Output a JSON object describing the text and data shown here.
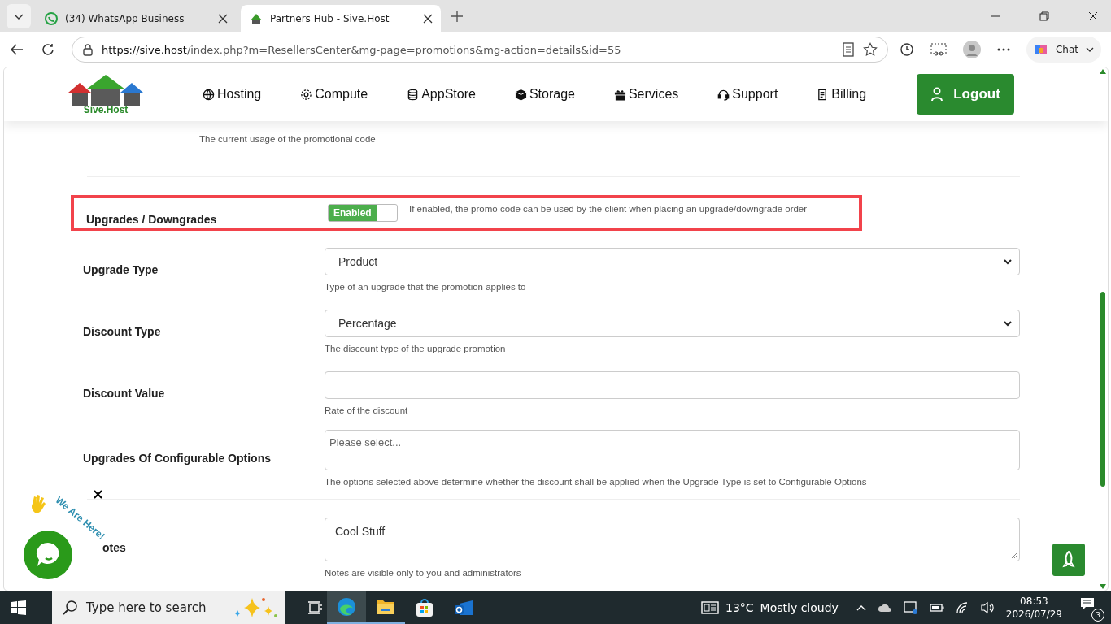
{
  "browser": {
    "tabs": [
      {
        "title": "(34) WhatsApp Business",
        "selected": false
      },
      {
        "title": "Partners Hub - Sive.Host",
        "selected": true
      }
    ],
    "url_host": "https://sive.host",
    "url_path": "/index.php?m=ResellersCenter&mg-page=promotions&mg-action=details&id=55",
    "chat_label": "Chat"
  },
  "site": {
    "logo_text": "Sive.Host",
    "nav": [
      {
        "label": "Hosting"
      },
      {
        "label": "Compute"
      },
      {
        "label": "AppStore"
      },
      {
        "label": "Storage"
      },
      {
        "label": "Services"
      },
      {
        "label": "Support"
      },
      {
        "label": "Billing"
      }
    ],
    "logout": "Logout"
  },
  "form": {
    "uses_hint": "The current usage of the promotional code",
    "rows": [
      {
        "kind": "toggle",
        "label": "Upgrades / Downgrades",
        "toggle_label": "Enabled",
        "on": true,
        "highlighted": true,
        "hint": "If enabled, the promo code can be used by the client when placing an upgrade/downgrade order"
      },
      {
        "kind": "select",
        "label": "Upgrade Type",
        "value": "Product",
        "hint": "Type of an upgrade that the promotion applies to"
      },
      {
        "kind": "select",
        "label": "Discount Type",
        "value": "Percentage",
        "hint": "The discount type of the upgrade promotion"
      },
      {
        "kind": "input",
        "label": "Discount Value",
        "hint": "Rate of the discount"
      },
      {
        "kind": "multiselect",
        "label": "Upgrades Of Configurable Options",
        "placeholder": "Please select...",
        "hint": "The options selected above determine whether the discount shall be applied when the Upgrade Type is set to Configurable Options"
      },
      {
        "kind": "textarea",
        "label": "otes",
        "value": "Cool Stuff",
        "hint": "Notes are visible only to you and administrators"
      }
    ]
  },
  "chat_widget": {
    "caption": "We Are Here!"
  },
  "taskbar": {
    "search_placeholder": "Type here to search",
    "apps": [
      {
        "kind": "edge",
        "selected": true,
        "running": true
      },
      {
        "kind": "explorer",
        "selected": false,
        "running": true
      },
      {
        "kind": "store",
        "selected": false,
        "running": false
      },
      {
        "kind": "outlook",
        "selected": false,
        "running": false
      }
    ],
    "temperature": "13°C",
    "weather": "Mostly cloudy",
    "time": "08:53",
    "date": "2026/07/29",
    "notifications": "3"
  }
}
